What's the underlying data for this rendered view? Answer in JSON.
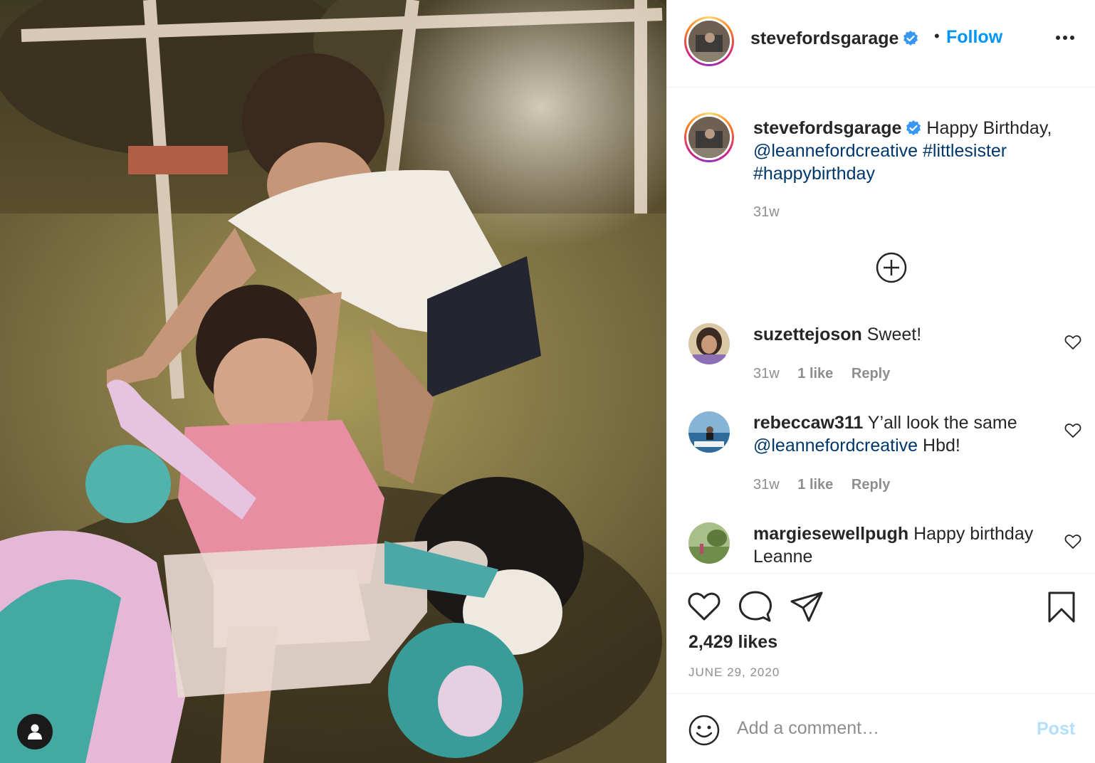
{
  "post": {
    "username": "stevefordsgarage",
    "follow_label": "Follow",
    "dot": "•",
    "caption": {
      "text": "Happy Birthday,",
      "mention": "@leannefordcreative",
      "tag1": "#littlesister",
      "tag2": "#happybirthday",
      "time": "31w"
    },
    "comments": [
      {
        "user": "suzettejoson",
        "text": "Sweet!",
        "time": "31w",
        "likes": "1 like",
        "reply": "Reply"
      },
      {
        "user": "rebeccaw311",
        "text": "Y’all look the same",
        "mention": "@leannefordcreative",
        "text_after": "Hbd!",
        "time": "31w",
        "likes": "1 like",
        "reply": "Reply"
      },
      {
        "user": "margiesewellpugh",
        "text": "Happy birthday Leanne"
      }
    ],
    "likes": "2,429 likes",
    "date": "JUNE 29, 2020",
    "comment_placeholder": "Add a comment…",
    "post_label": "Post"
  },
  "icons": {
    "verified": "verified-badge-icon",
    "more": "more-options-icon",
    "add": "load-more-comments-icon",
    "heart": "heart-icon",
    "comment": "comment-icon",
    "share": "share-icon",
    "save": "bookmark-icon",
    "emoji": "emoji-icon",
    "user": "user-tag-icon"
  },
  "colors": {
    "accent": "#0095f6",
    "link": "#00376b",
    "muted": "#8e8e8e",
    "post_disabled": "#b2dffc",
    "badge": "#3897f0"
  }
}
